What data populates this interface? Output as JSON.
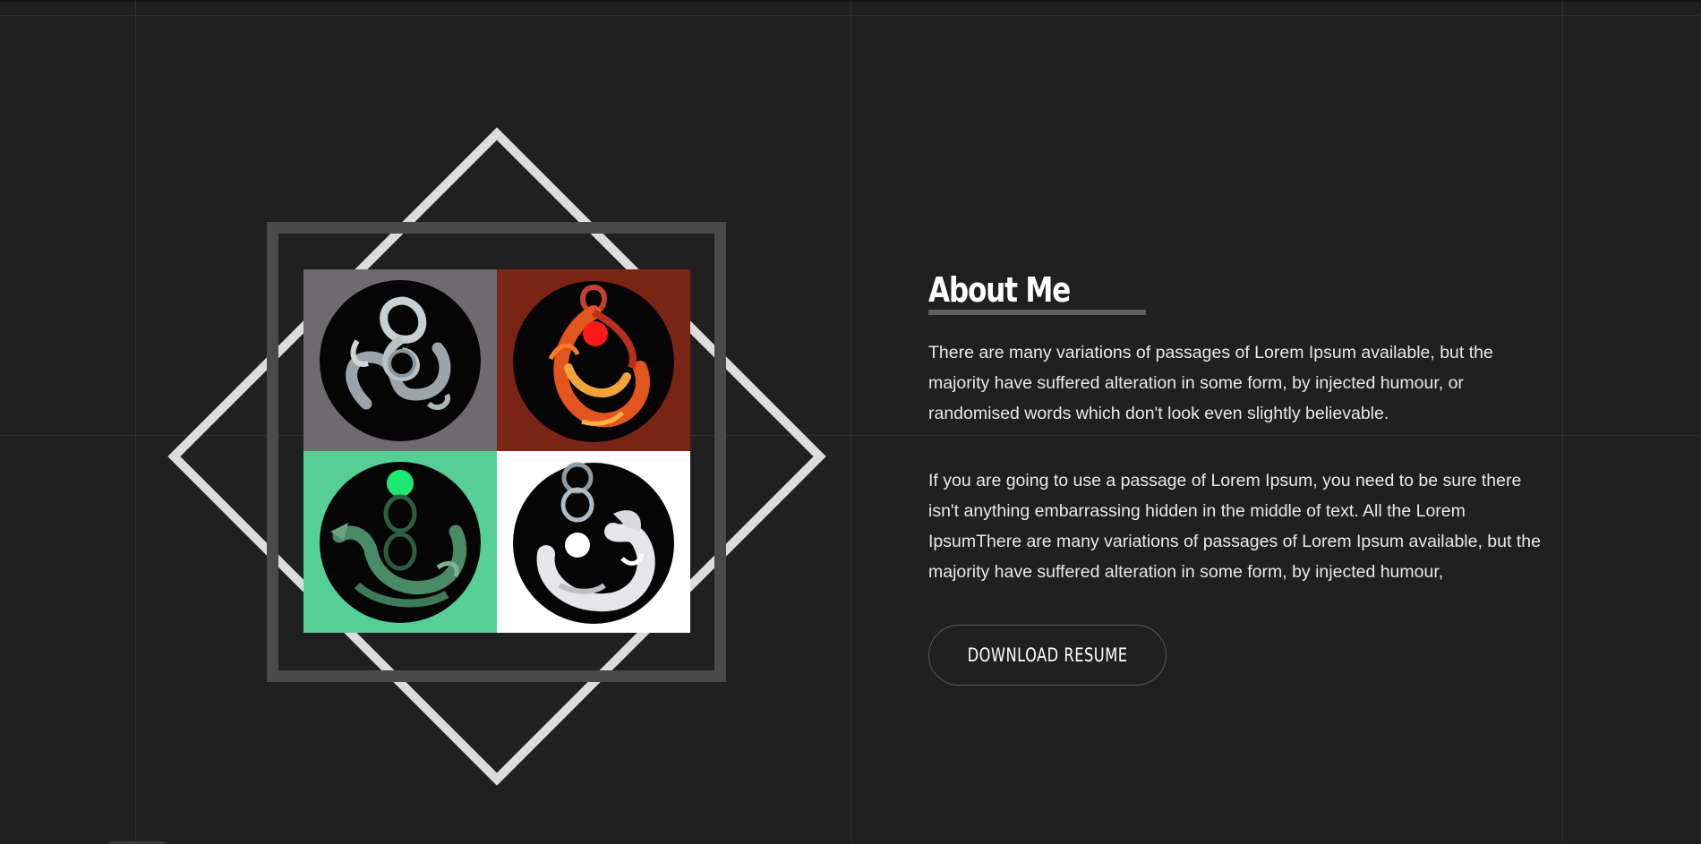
{
  "about": {
    "title": "About Me",
    "paragraph_1": "There are many variations of passages of Lorem Ipsum available, but the majority have suffered alteration in some form, by injected humour, or randomised words which don't look even slightly believable.",
    "paragraph_2": "If you are going to use a passage of Lorem Ipsum, you need to be sure there isn't anything embarrassing hidden in the middle of text. All the Lorem IpsumThere are many variations of passages of Lorem Ipsum available, but the majority have suffered alteration in some form, by injected humour,",
    "button_label": "DOWNLOAD RESUME"
  },
  "artwork": {
    "tiles": [
      {
        "name": "snake-emblem",
        "background": "#6e6a6e",
        "accent": "#2e2e30"
      },
      {
        "name": "phoenix-emblem",
        "background": "#7a2416",
        "accent": "#ff1a1a"
      },
      {
        "name": "dragon-emblem",
        "background": "#56cf97",
        "accent": "#1ee870"
      },
      {
        "name": "tiger-emblem",
        "background": "#ffffff",
        "accent": "#ffffff"
      }
    ]
  },
  "colors": {
    "background": "#202020",
    "text": "#ffffff",
    "diamond": "#dcdcdc",
    "frame": "#4a4a4a",
    "underline": "#606060"
  }
}
